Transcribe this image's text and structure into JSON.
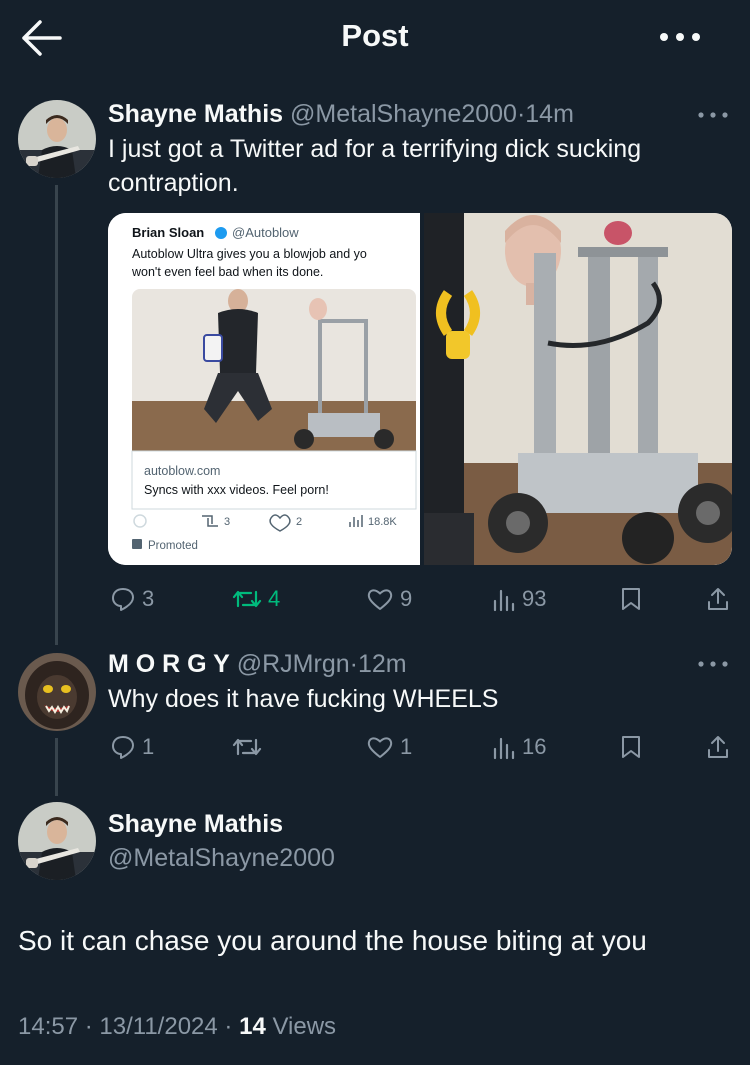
{
  "header": {
    "title": "Post"
  },
  "tweet1": {
    "name": "Shayne Mathis",
    "handle": "@MetalShayne2000",
    "sep": "·",
    "time": "14m",
    "text_line1": "I just got a Twitter ad for a terrifying dick sucking",
    "text_line2": "contraption.",
    "media_ad": {
      "name": "Brian Sloan",
      "handle": "@Autoblow",
      "text_line1": "Autoblow Ultra gives you a blowjob and yo",
      "text_line2": "won't even feel bad when its done.",
      "domain": "autoblow.com",
      "link_title": "Syncs with xxx videos. Feel porn!",
      "retweets": "3",
      "likes": "2",
      "views": "18.8K",
      "promoted": "Promoted"
    },
    "stats": {
      "replies": "3",
      "reposts": "4",
      "likes": "9",
      "views": "93"
    }
  },
  "reply": {
    "name": "M O R G Y",
    "handle": "@RJMrgn",
    "sep": "·",
    "time": "12m",
    "text": "Why does it have fucking WHEELS",
    "stats": {
      "replies": "1",
      "reposts": "",
      "likes": "1",
      "views": "16"
    }
  },
  "main_post": {
    "name": "Shayne Mathis",
    "handle": "@MetalShayne2000",
    "text": "So it can chase you around the house biting at you",
    "time": "14:57",
    "date": "13/11/2024",
    "views_count": "14",
    "views_label": "Views"
  },
  "colors": {
    "background": "#15202b",
    "muted": "#8b98a5",
    "repost_active": "#00ba7c",
    "thread_line": "#38444d"
  }
}
